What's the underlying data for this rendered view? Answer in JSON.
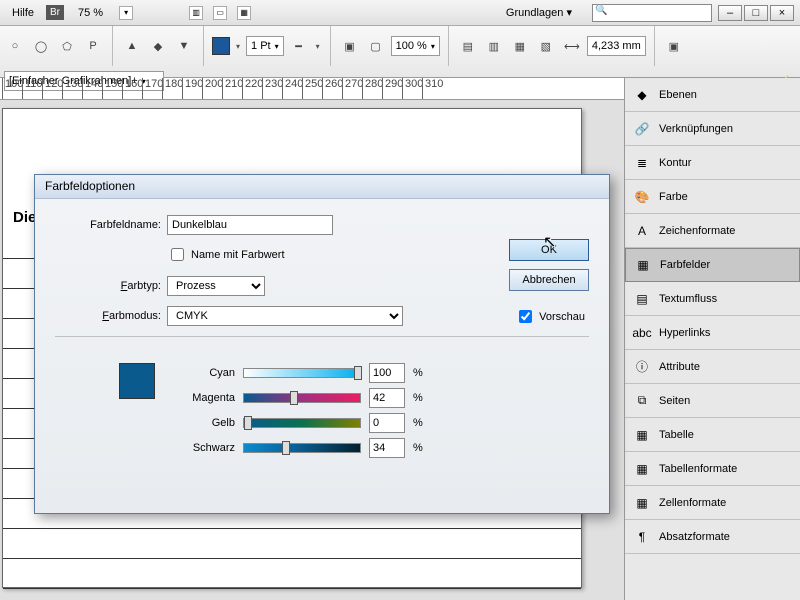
{
  "menubar": {
    "help": "Hilfe",
    "bridge_badge": "Br",
    "zoom": "75 %",
    "workspace_label": "Grundlagen",
    "search_placeholder": ""
  },
  "window_buttons": {
    "min": "–",
    "max": "□",
    "close": "×"
  },
  "toolbar": {
    "stroke_weight": "1 Pt",
    "scale": "100 %",
    "distance": "4,233 mm",
    "frame_style": "[Einfacher Grafikrahmen]+",
    "text_tool": "P"
  },
  "ruler": {
    "start": 100,
    "step": 10,
    "count": 22
  },
  "page": {
    "heading": "Die"
  },
  "panels": [
    {
      "id": "ebenen",
      "label": "Ebenen",
      "icon": "◆"
    },
    {
      "id": "verknuepfungen",
      "label": "Verknüpfungen",
      "icon": "🔗"
    },
    {
      "id": "kontur",
      "label": "Kontur",
      "icon": "≣"
    },
    {
      "id": "farbe",
      "label": "Farbe",
      "icon": "🎨"
    },
    {
      "id": "zeichenformate",
      "label": "Zeichenformate",
      "icon": "A"
    },
    {
      "id": "farbfelder",
      "label": "Farbfelder",
      "icon": "▦",
      "active": true
    },
    {
      "id": "textumfluss",
      "label": "Textumfluss",
      "icon": "▤"
    },
    {
      "id": "hyperlinks",
      "label": "Hyperlinks",
      "icon": "abc"
    },
    {
      "id": "attribute",
      "label": "Attribute",
      "icon": "ⓘ"
    },
    {
      "id": "seiten",
      "label": "Seiten",
      "icon": "⧉"
    },
    {
      "id": "tabelle",
      "label": "Tabelle",
      "icon": "▦"
    },
    {
      "id": "tabellenformate",
      "label": "Tabellenformate",
      "icon": "▦"
    },
    {
      "id": "zellenformate",
      "label": "Zellenformate",
      "icon": "▦"
    },
    {
      "id": "absatzformate",
      "label": "Absatzformate",
      "icon": "¶"
    }
  ],
  "dialog": {
    "title": "Farbfeldoptionen",
    "name_label": "Farbfeldname:",
    "name_value": "Dunkelblau",
    "name_with_value_label": "Name mit Farbwert",
    "name_with_value_checked": false,
    "type_label": "Farbtyp:",
    "type_value": "Prozess",
    "mode_label": "Farbmodus:",
    "mode_value": "CMYK",
    "ok": "OK",
    "cancel": "Abbrechen",
    "preview_label": "Vorschau",
    "preview_checked": true,
    "channels": {
      "cyan": {
        "label": "Cyan",
        "value": "100"
      },
      "magenta": {
        "label": "Magenta",
        "value": "42"
      },
      "gelb": {
        "label": "Gelb",
        "value": "0"
      },
      "schwarz": {
        "label": "Schwarz",
        "value": "34"
      }
    },
    "pct": "%"
  }
}
